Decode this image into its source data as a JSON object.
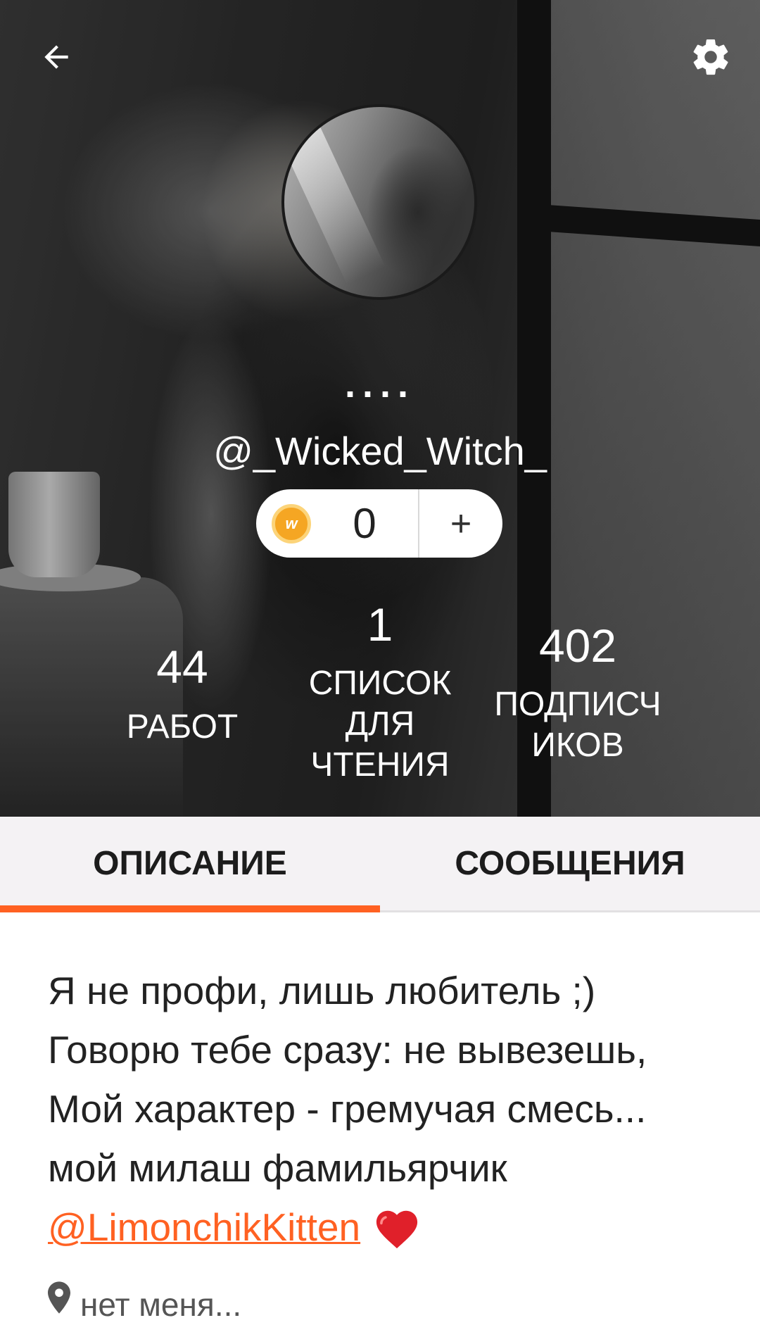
{
  "header": {
    "display_name": "....",
    "username": "@_Wicked_Witch_",
    "back_icon": "arrow-left-icon",
    "settings_icon": "gear-icon"
  },
  "coins": {
    "icon": "wattpad-coin-icon",
    "icon_letter": "w",
    "count": "0",
    "add_label": "+"
  },
  "stats": [
    {
      "value": "44",
      "label": "РАБОТ"
    },
    {
      "value": "1",
      "label": "СПИСОК ДЛЯ ЧТЕНИЯ"
    },
    {
      "value": "402",
      "label": "ПОДПИСЧ ИКОВ"
    }
  ],
  "tabs": [
    {
      "label": "ОПИСАНИЕ",
      "active": true
    },
    {
      "label": "СООБЩЕНИЯ",
      "active": false
    }
  ],
  "description": {
    "lines": [
      "Я не профи, лишь любитель ;)",
      "Говорю тебе сразу: не вывезешь,",
      "Мой характер - гремучая смесь...",
      "мой милаш фамильярчик"
    ],
    "mention": "@LimonchikKitten",
    "emoji": "❤️"
  },
  "location": {
    "icon": "location-pin-icon",
    "text": "нет меня..."
  },
  "colors": {
    "accent": "#ff6122",
    "coin": "#f5a623",
    "heart": "#e0202a"
  }
}
